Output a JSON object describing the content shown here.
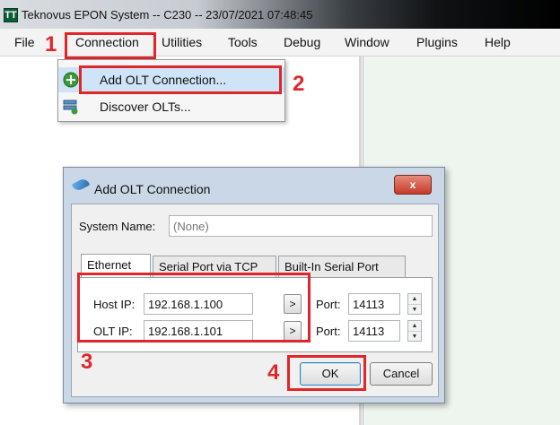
{
  "window": {
    "app_icon": "TT",
    "title": "Teknovus EPON System -- C230 -- 23/07/2021 07:48:45"
  },
  "menubar": {
    "items": [
      "File",
      "Connection",
      "Utilities",
      "Tools",
      "Debug",
      "Window",
      "Plugins",
      "Help"
    ]
  },
  "connection_menu": {
    "items": [
      {
        "label": "Add OLT Connection...",
        "icon": "add-connection-icon",
        "highlighted": true
      },
      {
        "label": "Discover OLTs...",
        "icon": "discover-olts-icon",
        "highlighted": false
      }
    ]
  },
  "dialog": {
    "title": "Add OLT Connection",
    "close_label": "x",
    "system_name_label": "System Name:",
    "system_name_placeholder": "(None)",
    "tabs": [
      "Ethernet",
      "Serial Port via TCP",
      "Built-In Serial Port"
    ],
    "active_tab": "Ethernet",
    "host_ip_label": "Host IP:",
    "host_ip_value": "192.168.1.100",
    "host_port_label": "Port:",
    "host_port_value": "14113",
    "olt_ip_label": "OLT IP:",
    "olt_ip_value": "192.168.1.101",
    "olt_port_label": "Port:",
    "olt_port_value": "14113",
    "arrow_label": ">",
    "ok_label": "OK",
    "cancel_label": "Cancel"
  },
  "annotations": {
    "step1": "1",
    "step2": "2",
    "step3": "3",
    "step4": "4",
    "color": "#e0262a"
  }
}
